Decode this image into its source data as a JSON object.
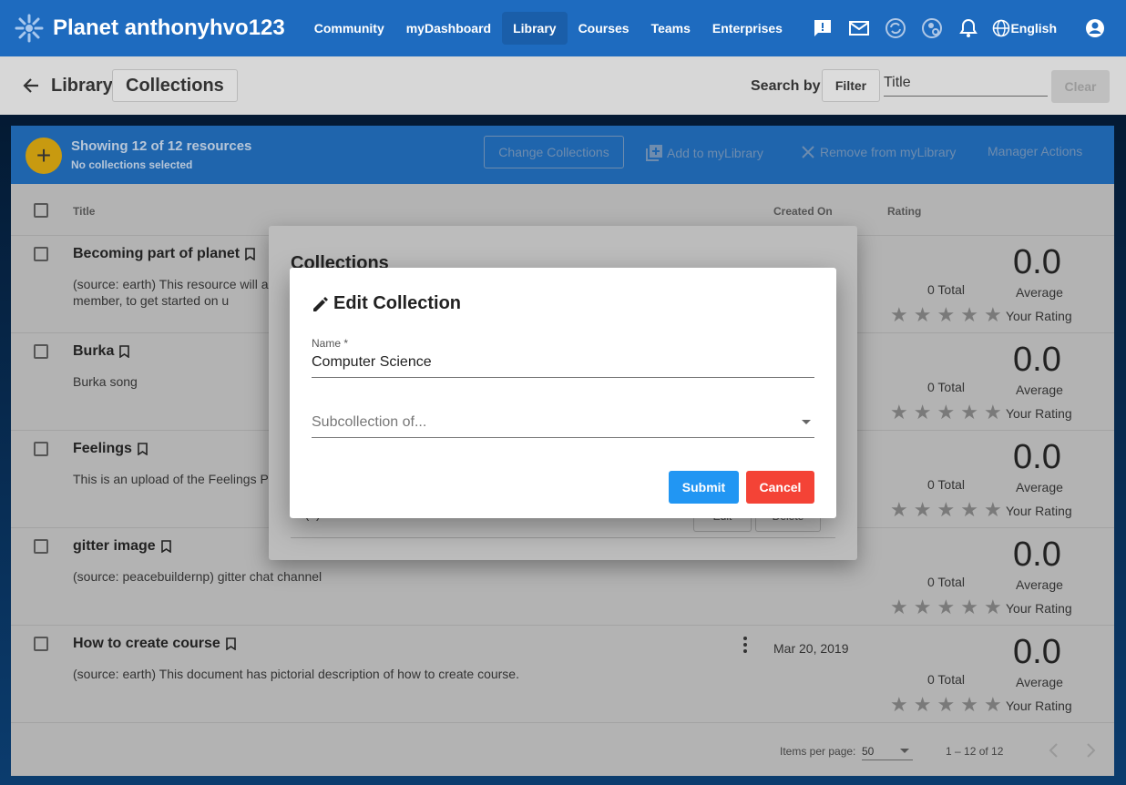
{
  "header": {
    "title": "Planet anthonyhvo123",
    "nav": [
      "Community",
      "myDashboard",
      "Library",
      "Courses",
      "Teams",
      "Enterprises"
    ],
    "active_nav": "Library",
    "language": "English",
    "brand_color": "#1e6bbf"
  },
  "toolbar": {
    "breadcrumb_root": "Library",
    "breadcrumb_current": "Collections",
    "search_label": "Search by:",
    "filter_label": "Filter",
    "title_value": "Title",
    "clear_label": "Clear"
  },
  "action_bar": {
    "showing": "Showing 12 of 12 resources",
    "selection": "No collections selected",
    "change_collections": "Change Collections",
    "add_library": "Add to myLibrary",
    "remove_library": "Remove from myLibrary",
    "manager_actions": "Manager Actions"
  },
  "table": {
    "headers": {
      "title": "Title",
      "created": "Created On",
      "rating": "Rating"
    },
    "rows": [
      {
        "title": "Becoming part of planet",
        "desc": "(source: earth) This resource will already member, to get started on u",
        "date": "",
        "total": "0 Total",
        "avg": "0.0",
        "avg_label": "Average",
        "your_rating": "Your Rating"
      },
      {
        "title": "Burka",
        "desc": "Burka song",
        "date": "",
        "total": "0 Total",
        "avg": "0.0",
        "avg_label": "Average",
        "your_rating": "Your Rating"
      },
      {
        "title": "Feelings",
        "desc": "This is an upload of the Feelings Pl",
        "date": "",
        "total": "0 Total",
        "avg": "0.0",
        "avg_label": "Average",
        "your_rating": "Your Rating"
      },
      {
        "title": "gitter image",
        "desc": "(source: peacebuildernp) gitter chat channel",
        "date": "",
        "total": "0 Total",
        "avg": "0.0",
        "avg_label": "Average",
        "your_rating": "Your Rating"
      },
      {
        "title": "How to create course",
        "desc": "(source: earth) This document has pictorial description of how to create course.",
        "date": "Mar 20, 2019",
        "total": "0 Total",
        "avg": "0.0",
        "avg_label": "Average",
        "your_rating": "Your Rating"
      }
    ]
  },
  "footer": {
    "items_per_page_label": "Items per page:",
    "items_per_page": "50",
    "range": "1 – 12 of 12"
  },
  "collections_dialog": {
    "title": "Collections",
    "row_text": "1. (0)",
    "edit_label": "Edit",
    "delete_label": "Delete"
  },
  "edit_dialog": {
    "title": "Edit Collection",
    "name_label": "Name *",
    "name_value": "Computer Science",
    "subcollection_placeholder": "Subcollection of...",
    "submit": "Submit",
    "cancel": "Cancel"
  }
}
